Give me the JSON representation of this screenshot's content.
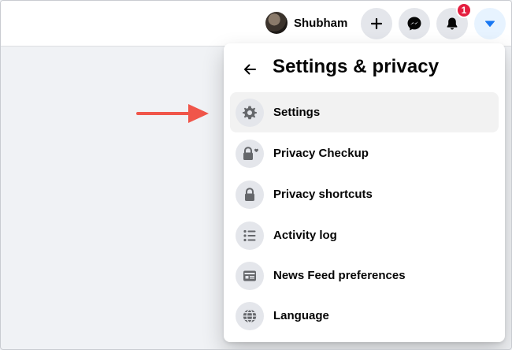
{
  "topbar": {
    "profile_name": "Shubham",
    "notification_count": "1",
    "create_icon": "plus-icon",
    "messenger_icon": "messenger-icon",
    "notifications_icon": "bell-icon",
    "account_icon": "caret-down-icon"
  },
  "menu": {
    "title": "Settings & privacy",
    "back_icon": "arrow-left-icon",
    "items": [
      {
        "label": "Settings",
        "icon": "gear-icon"
      },
      {
        "label": "Privacy Checkup",
        "icon": "lock-heart-icon"
      },
      {
        "label": "Privacy shortcuts",
        "icon": "lock-icon"
      },
      {
        "label": "Activity log",
        "icon": "list-icon"
      },
      {
        "label": "News Feed preferences",
        "icon": "feed-icon"
      },
      {
        "label": "Language",
        "icon": "globe-icon"
      }
    ]
  },
  "colors": {
    "accent": "#1877f2",
    "annotation_arrow": "#f0564a",
    "badge": "#e41e3f"
  }
}
